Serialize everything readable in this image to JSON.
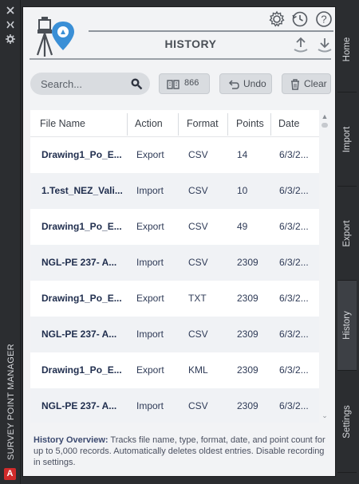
{
  "app": {
    "vertical_title": "SURVEY POINT MANAGER",
    "strip_buttons": [
      "close-icon",
      "pin-icon",
      "gear-icon"
    ]
  },
  "header": {
    "title": "HISTORY",
    "icons": [
      "gear-icon",
      "history-icon",
      "help-icon",
      "upload-icon",
      "download-icon"
    ]
  },
  "toolbar": {
    "search_placeholder": "Search...",
    "count_label": "866",
    "undo_label": "Undo",
    "clear_label": "Clear"
  },
  "table": {
    "columns": [
      "File Name",
      "Action",
      "Format",
      "Points",
      "Date"
    ],
    "rows": [
      {
        "file": "Drawing1_Po_E...",
        "action": "Export",
        "format": "CSV",
        "points": "14",
        "date": "6/3/2..."
      },
      {
        "file": "1.Test_NEZ_Vali...",
        "action": "Import",
        "format": "CSV",
        "points": "10",
        "date": "6/3/2..."
      },
      {
        "file": "Drawing1_Po_E...",
        "action": "Export",
        "format": "CSV",
        "points": "49",
        "date": "6/3/2..."
      },
      {
        "file": "NGL-PE 237- A...",
        "action": "Import",
        "format": "CSV",
        "points": "2309",
        "date": "6/3/2..."
      },
      {
        "file": "Drawing1_Po_E...",
        "action": "Export",
        "format": "TXT",
        "points": "2309",
        "date": "6/3/2..."
      },
      {
        "file": "NGL-PE 237- A...",
        "action": "Import",
        "format": "CSV",
        "points": "2309",
        "date": "6/3/2..."
      },
      {
        "file": "Drawing1_Po_E...",
        "action": "Export",
        "format": "KML",
        "points": "2309",
        "date": "6/3/2..."
      },
      {
        "file": "NGL-PE 237- A...",
        "action": "Import",
        "format": "CSV",
        "points": "2309",
        "date": "6/3/2..."
      }
    ]
  },
  "overview": {
    "label": "History Overview:",
    "text": "Tracks file name, type, format, date, and point count for up to 5,000 records. Automatically deletes oldest entries. Disable recording in settings."
  },
  "tabs": [
    {
      "label": "Home",
      "active": false
    },
    {
      "label": "Import",
      "active": false
    },
    {
      "label": "Export",
      "active": false
    },
    {
      "label": "History",
      "active": true
    },
    {
      "label": "Settings",
      "active": false
    }
  ],
  "colors": {
    "panel_bg": "#f2f3f5",
    "frame_bg": "#2b2d30",
    "accent_blue": "#3a8fd6",
    "text_navy": "#1f2d4d"
  }
}
